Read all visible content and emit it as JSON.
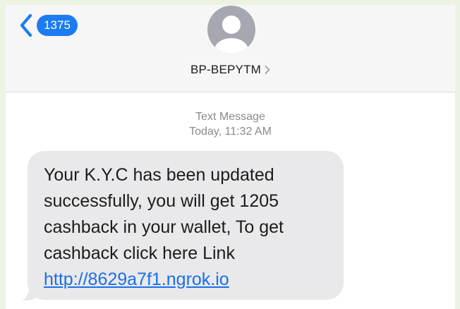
{
  "header": {
    "back_badge": "1375",
    "contact_name": "BP-BEPYTM",
    "back_icon": "chevron-left-icon",
    "avatar_icon": "person-avatar-icon",
    "contact_chevron_icon": "chevron-right-icon"
  },
  "meta": {
    "label": "Text Message",
    "timestamp": "Today, 11:32 AM"
  },
  "message": {
    "lines": [
      "Your K.Y.C has been updated",
      "successfully, you will get 1205",
      "cashback in your wallet, To get",
      "cashback click here Link"
    ],
    "link": "http://8629a7f1.ngrok.io"
  },
  "colors": {
    "accent": "#1c7cf1",
    "link": "#1c6fe6",
    "bubble": "#e9e9eb",
    "meta_text": "#8a8a8e",
    "page_frame": "#edf3e2"
  }
}
